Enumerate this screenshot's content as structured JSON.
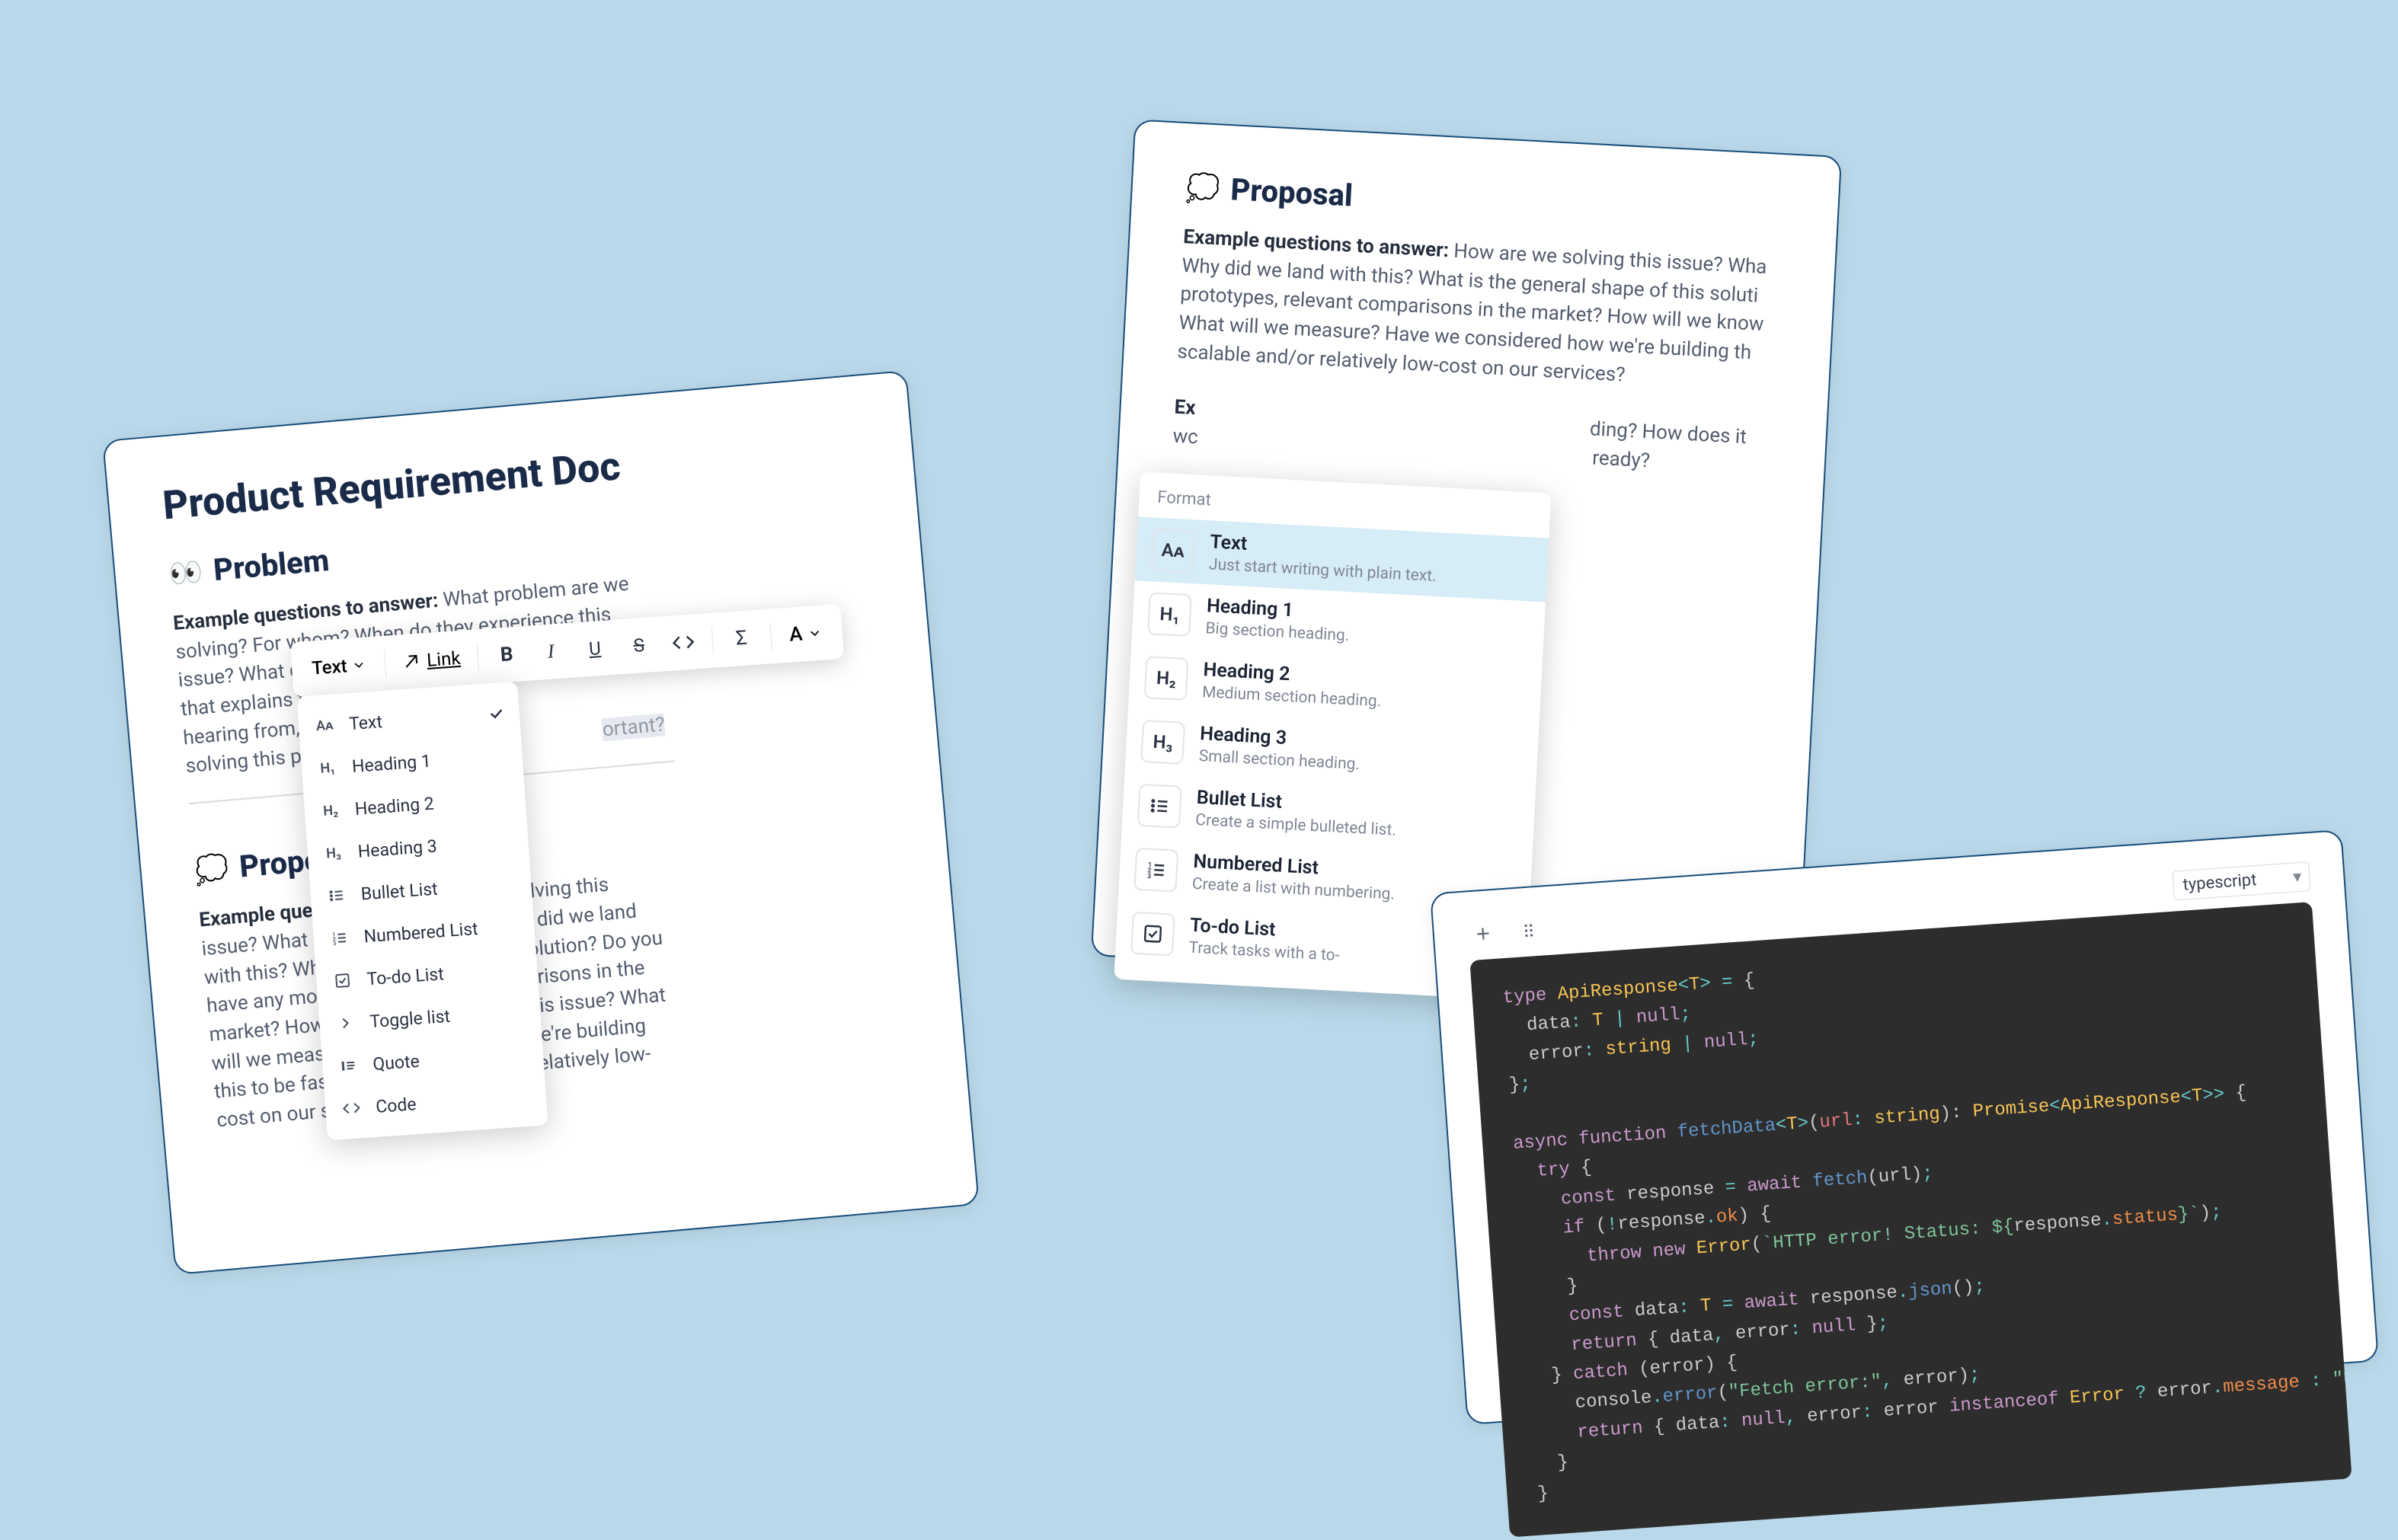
{
  "leftPanel": {
    "title": "Product Requirement Doc",
    "problemTitle": "Problem",
    "problemEmoji": "👀",
    "questionsLabel": "Example questions to answer:",
    "problemBody": "What problem are we solving? For whom? When do they experience this issue? What data, research and feedback do we have that explains this problem?",
    "problemBody2a": "hearing from,",
    "problemBody2b": "solving this pr",
    "problemHighlight": "ortant?",
    "proposalTitle": "Propo",
    "proposalEmoji": "💭",
    "proposalQuestionsLabel": "Example ques",
    "proposalBody1": "e solving this",
    "proposalBody2": "issue? What a",
    "proposalBody3": "Why did we land",
    "proposalBody4": "with this? Wha",
    "proposalBody5": "s solution? Do you",
    "proposalBody6": "have any moc",
    "proposalBody7": "mparisons in the",
    "proposalBody8": "market? How",
    "proposalBody9": "ed this issue? What",
    "proposalBody10": "will we measu",
    "proposalBody11": "w we're building",
    "proposalBody12": "this to be fast,",
    "proposalBody13": "or relatively low-",
    "proposalBody14": "cost on our services?"
  },
  "toolbar": {
    "type": "Text",
    "link": "Link"
  },
  "formatList": {
    "items": [
      {
        "icon": "Aᴀ",
        "label": "Text",
        "checked": true
      },
      {
        "icon": "H₁",
        "label": "Heading 1"
      },
      {
        "icon": "H₂",
        "label": "Heading 2"
      },
      {
        "icon": "H₃",
        "label": "Heading 3"
      },
      {
        "icon": "ul",
        "label": "Bullet List"
      },
      {
        "icon": "ol",
        "label": "Numbered List"
      },
      {
        "icon": "todo",
        "label": "To-do List"
      },
      {
        "icon": "toggle",
        "label": "Toggle list"
      },
      {
        "icon": "quote",
        "label": "Quote"
      },
      {
        "icon": "code",
        "label": "Code"
      }
    ]
  },
  "rightPanel": {
    "proposalTitle": "Proposal",
    "proposalEmoji": "💭",
    "questionsLabel": "Example questions to answer:",
    "proposalBody": "How are we solving this issue? Wha Why did we land with this? What is the general shape of this soluti prototypes, relevant comparisons in the market? How will we know What will we measure? Have we considered how we're building th scalable and/or relatively low-cost on our services?",
    "line2a": "Ex",
    "line2b": "ding? How does it",
    "line3a": "wc",
    "line3b": "ready?",
    "slash": "/"
  },
  "formatPanel": {
    "header": "Format",
    "items": [
      {
        "icon": "Aᴀ",
        "title": "Text",
        "desc": "Just start writing with plain text.",
        "selected": true
      },
      {
        "icon": "H₁",
        "title": "Heading 1",
        "desc": "Big section heading."
      },
      {
        "icon": "H₂",
        "title": "Heading 2",
        "desc": "Medium section heading."
      },
      {
        "icon": "H₃",
        "title": "Heading 3",
        "desc": "Small section heading."
      },
      {
        "icon": "ul",
        "title": "Bullet List",
        "desc": "Create a simple bulleted list."
      },
      {
        "icon": "ol",
        "title": "Numbered List",
        "desc": "Create a list with numbering."
      },
      {
        "icon": "todo",
        "title": "To-do List",
        "desc": "Track tasks with a to-"
      }
    ]
  },
  "codePanel": {
    "lang": "typescript",
    "lines": [
      [
        [
          "kw",
          "type"
        ],
        [
          "var",
          " "
        ],
        [
          "type",
          "ApiResponse"
        ],
        [
          "op",
          "<"
        ],
        [
          "type",
          "T"
        ],
        [
          "op",
          ">"
        ],
        [
          "var",
          " "
        ],
        [
          "op",
          "="
        ],
        [
          "var",
          " {"
        ]
      ],
      [
        [
          "var",
          "  data"
        ],
        [
          "op",
          ":"
        ],
        [
          "var",
          " "
        ],
        [
          "type",
          "T"
        ],
        [
          "var",
          " "
        ],
        [
          "op",
          "|"
        ],
        [
          "var",
          " "
        ],
        [
          "null",
          "null"
        ],
        [
          "op",
          ";"
        ]
      ],
      [
        [
          "var",
          "  error"
        ],
        [
          "op",
          ":"
        ],
        [
          "var",
          " "
        ],
        [
          "type",
          "string"
        ],
        [
          "var",
          " "
        ],
        [
          "op",
          "|"
        ],
        [
          "var",
          " "
        ],
        [
          "null",
          "null"
        ],
        [
          "op",
          ";"
        ]
      ],
      [
        [
          "var",
          "}"
        ],
        [
          "op",
          ";"
        ]
      ],
      [
        [
          "var",
          " "
        ]
      ],
      [
        [
          "kw",
          "async"
        ],
        [
          "var",
          " "
        ],
        [
          "kw",
          "function"
        ],
        [
          "var",
          " "
        ],
        [
          "fn",
          "fetchData"
        ],
        [
          "op",
          "<"
        ],
        [
          "type",
          "T"
        ],
        [
          "op",
          ">"
        ],
        [
          "var",
          "("
        ],
        [
          "par",
          "url"
        ],
        [
          "op",
          ":"
        ],
        [
          "var",
          " "
        ],
        [
          "type",
          "string"
        ],
        [
          "var",
          "): "
        ],
        [
          "type",
          "Promise"
        ],
        [
          "op",
          "<"
        ],
        [
          "type",
          "ApiResponse"
        ],
        [
          "op",
          "<"
        ],
        [
          "type",
          "T"
        ],
        [
          "op",
          ">>"
        ],
        [
          "var",
          " {"
        ]
      ],
      [
        [
          "var",
          "  "
        ],
        [
          "kw",
          "try"
        ],
        [
          "var",
          " {"
        ]
      ],
      [
        [
          "var",
          "    "
        ],
        [
          "kw",
          "const"
        ],
        [
          "var",
          " response "
        ],
        [
          "op",
          "="
        ],
        [
          "var",
          " "
        ],
        [
          "kw",
          "await"
        ],
        [
          "var",
          " "
        ],
        [
          "fn",
          "fetch"
        ],
        [
          "var",
          "(url)"
        ],
        [
          "op",
          ";"
        ]
      ],
      [
        [
          "var",
          "    "
        ],
        [
          "kw",
          "if"
        ],
        [
          "var",
          " ("
        ],
        [
          "op",
          "!"
        ],
        [
          "var",
          "response"
        ],
        [
          "op",
          "."
        ],
        [
          "prop",
          "ok"
        ],
        [
          "var",
          ") {"
        ]
      ],
      [
        [
          "var",
          "      "
        ],
        [
          "kw",
          "throw"
        ],
        [
          "var",
          " "
        ],
        [
          "kw",
          "new"
        ],
        [
          "var",
          " "
        ],
        [
          "type",
          "Error"
        ],
        [
          "var",
          "("
        ],
        [
          "str",
          "`HTTP error! Status: ${"
        ],
        [
          "var",
          "response"
        ],
        [
          "op",
          "."
        ],
        [
          "prop",
          "status"
        ],
        [
          "str",
          "}`"
        ],
        [
          "var",
          ")"
        ],
        [
          "op",
          ";"
        ]
      ],
      [
        [
          "var",
          "    }"
        ]
      ],
      [
        [
          "var",
          "    "
        ],
        [
          "kw",
          "const"
        ],
        [
          "var",
          " data"
        ],
        [
          "op",
          ":"
        ],
        [
          "var",
          " "
        ],
        [
          "type",
          "T"
        ],
        [
          "var",
          " "
        ],
        [
          "op",
          "="
        ],
        [
          "var",
          " "
        ],
        [
          "kw",
          "await"
        ],
        [
          "var",
          " response"
        ],
        [
          "op",
          "."
        ],
        [
          "fn",
          "json"
        ],
        [
          "var",
          "()"
        ],
        [
          "op",
          ";"
        ]
      ],
      [
        [
          "var",
          "    "
        ],
        [
          "kw",
          "return"
        ],
        [
          "var",
          " { data"
        ],
        [
          "op",
          ","
        ],
        [
          "var",
          " error"
        ],
        [
          "op",
          ":"
        ],
        [
          "var",
          " "
        ],
        [
          "null",
          "null"
        ],
        [
          "var",
          " }"
        ],
        [
          "op",
          ";"
        ]
      ],
      [
        [
          "var",
          "  } "
        ],
        [
          "kw",
          "catch"
        ],
        [
          "var",
          " (error) {"
        ]
      ],
      [
        [
          "var",
          "    console"
        ],
        [
          "op",
          "."
        ],
        [
          "fn",
          "error"
        ],
        [
          "var",
          "("
        ],
        [
          "str",
          "\"Fetch error:\""
        ],
        [
          "op",
          ","
        ],
        [
          "var",
          " error)"
        ],
        [
          "op",
          ";"
        ]
      ],
      [
        [
          "var",
          "    "
        ],
        [
          "kw",
          "return"
        ],
        [
          "var",
          " { data"
        ],
        [
          "op",
          ":"
        ],
        [
          "var",
          " "
        ],
        [
          "null",
          "null"
        ],
        [
          "op",
          ","
        ],
        [
          "var",
          " error"
        ],
        [
          "op",
          ":"
        ],
        [
          "var",
          " error "
        ],
        [
          "kw",
          "instanceof"
        ],
        [
          "var",
          " "
        ],
        [
          "type",
          "Error"
        ],
        [
          "var",
          " "
        ],
        [
          "op",
          "?"
        ],
        [
          "var",
          " error"
        ],
        [
          "op",
          "."
        ],
        [
          "prop",
          "message"
        ],
        [
          "var",
          " "
        ],
        [
          "op",
          ":"
        ],
        [
          "var",
          " "
        ],
        [
          "str",
          "\"Unknown error\""
        ],
        [
          "var",
          " }"
        ],
        [
          "op",
          ";"
        ]
      ],
      [
        [
          "var",
          "  }"
        ]
      ],
      [
        [
          "var",
          "}"
        ]
      ]
    ]
  }
}
